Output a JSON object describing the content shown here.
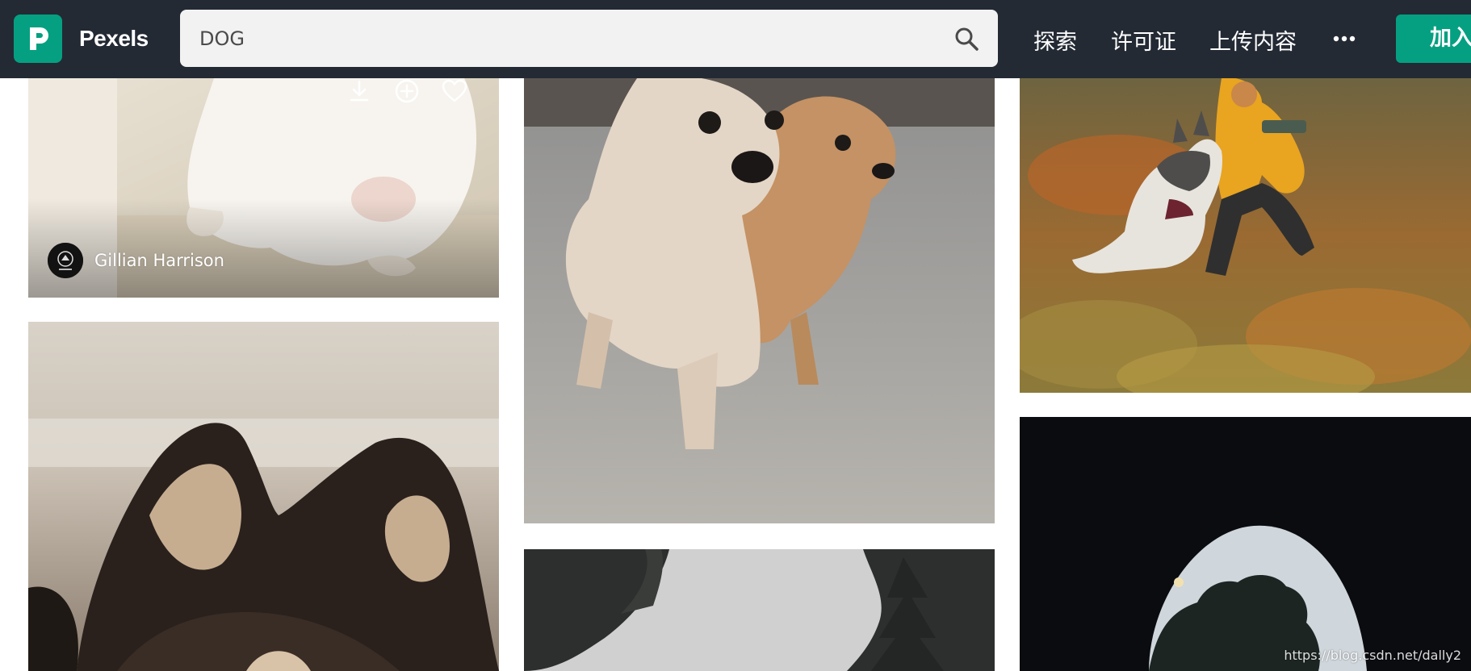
{
  "header": {
    "brand": "Pexels",
    "search": {
      "value": "DOG"
    },
    "nav": {
      "explore": "探索",
      "license": "许可证",
      "upload": "上传内容"
    },
    "join_label": "加入"
  },
  "photos": {
    "card1": {
      "author": "Gillian Harrison"
    }
  },
  "watermark": "https://blog.csdn.net/dally2",
  "colors": {
    "header_bg": "#232a34",
    "brand_green": "#05a081",
    "search_bg": "#f2f2f2"
  },
  "icons": [
    "pexels-logo-icon",
    "search-icon",
    "more-icon",
    "download-icon",
    "add-to-collection-icon",
    "heart-icon"
  ]
}
